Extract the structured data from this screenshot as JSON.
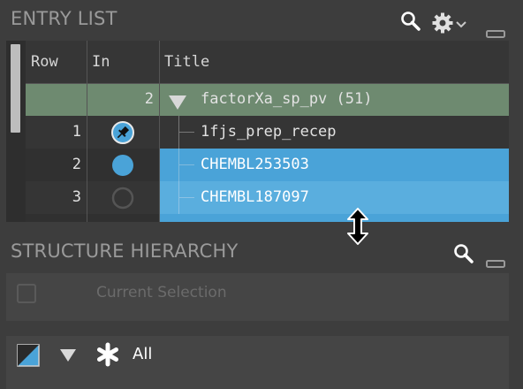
{
  "entry_list": {
    "title": "ENTRY LIST",
    "icons": [
      "search-icon",
      "gear-icon",
      "chevron-down-icon",
      "minimize-icon"
    ],
    "columns": [
      "Row",
      "In",
      "Title"
    ],
    "group": {
      "in": "2",
      "title": "factorXa_sp_pv (51)"
    },
    "rows": [
      {
        "row": "1",
        "title": "1fjs_prep_recep",
        "inclusion": "pinned",
        "selected": false
      },
      {
        "row": "2",
        "title": "CHEMBL253503",
        "inclusion": "included",
        "selected": true
      },
      {
        "row": "3",
        "title": "CHEMBL187097",
        "inclusion": "excluded",
        "selected": true
      }
    ]
  },
  "structure_hierarchy": {
    "title": "STRUCTURE HIERARCHY",
    "icons": [
      "search-icon",
      "minimize-icon"
    ],
    "current_selection": "Current Selection",
    "all_label": "All"
  },
  "colors": {
    "group_row": "#6e8a70",
    "selection": "#4aa3d8",
    "included_dot": "#4aa3d8",
    "background": "#3d3d3d"
  }
}
